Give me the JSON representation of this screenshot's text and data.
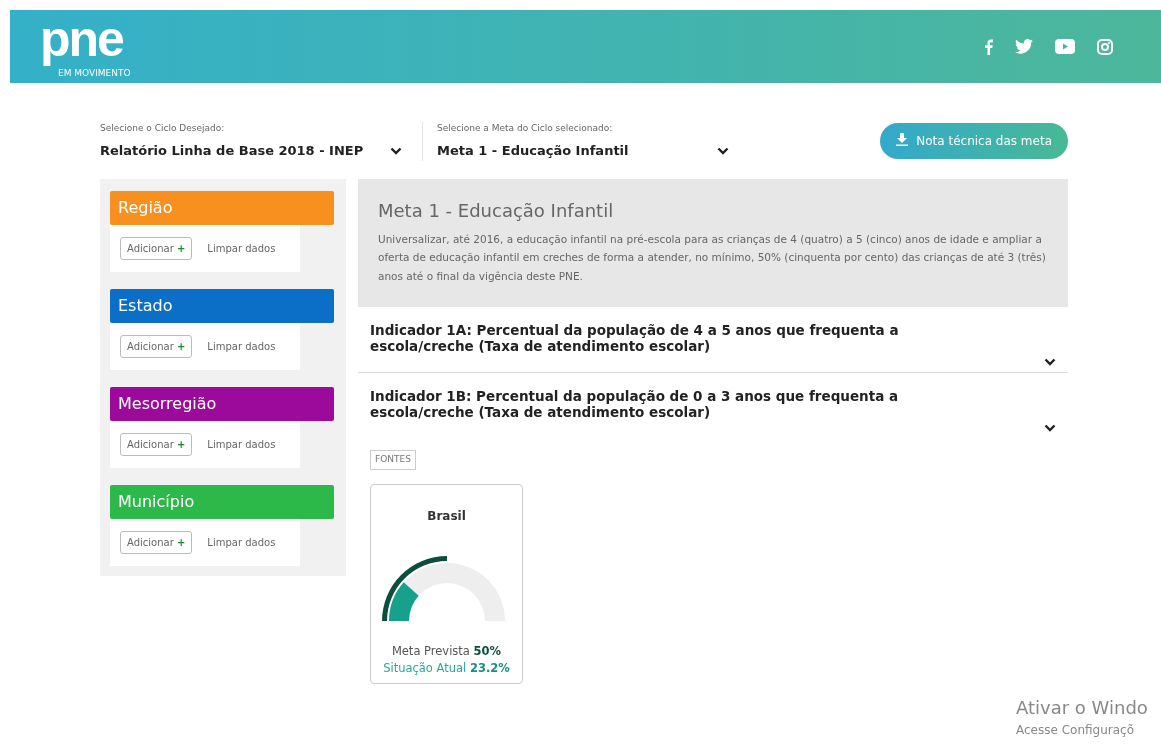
{
  "header": {
    "logo": "pne",
    "logo_subtitle": "EM MOVIMENTO"
  },
  "selectors": [
    {
      "label": "Selecione o Ciclo Desejado:",
      "value": "Relatório Linha de Base 2018 - INEP"
    },
    {
      "label": "Selecione a Meta do Ciclo selecionado:",
      "value": "Meta 1 - Educação Infantil"
    }
  ],
  "download_button": "Nota técnica das meta",
  "filters": [
    {
      "title": "Região",
      "color": "#f7901e",
      "add": "Adicionar",
      "add_icon": "+",
      "clear": "Limpar dados"
    },
    {
      "title": "Estado",
      "color": "#0b6fc7",
      "add": "Adicionar",
      "add_icon": "+",
      "clear": "Limpar dados"
    },
    {
      "title": "Mesorregião",
      "color": "#9c0a9c",
      "add": "Adicionar",
      "add_icon": "+",
      "clear": "Limpar dados"
    },
    {
      "title": "Município",
      "color": "#2db84a",
      "add": "Adicionar",
      "add_icon": "+",
      "clear": "Limpar dados"
    }
  ],
  "goal": {
    "title": "Meta 1 - Educação Infantil",
    "description": "Universalizar, até 2016, a educação infantil na pré-escola para as crianças de 4 (quatro) a 5 (cinco) anos de idade e ampliar a oferta de educação infantil em creches de forma a atender, no mínimo, 50% (cinquenta por cento) das crianças de até 3 (três) anos até o final da vigência deste PNE."
  },
  "indicators": [
    {
      "title": "Indicador 1A: Percentual da população de 4 a 5 anos que frequenta a escola/creche (Taxa de atendimento escolar)"
    },
    {
      "title": "Indicador 1B: Percentual da população de 0 a 3 anos que frequenta a escola/creche (Taxa de atendimento escolar)"
    }
  ],
  "sources_tag": "FONTES",
  "gauge": {
    "title": "Brasil",
    "target": {
      "label": "Meta Prevista",
      "value": "50%",
      "level": 0.5
    },
    "current": {
      "label": "Situação Atual",
      "value": "23.2%",
      "level": 0.232
    }
  },
  "os_notice": {
    "title": "Ativar o Windo",
    "subtitle": "Acesse Configuraçõ"
  }
}
